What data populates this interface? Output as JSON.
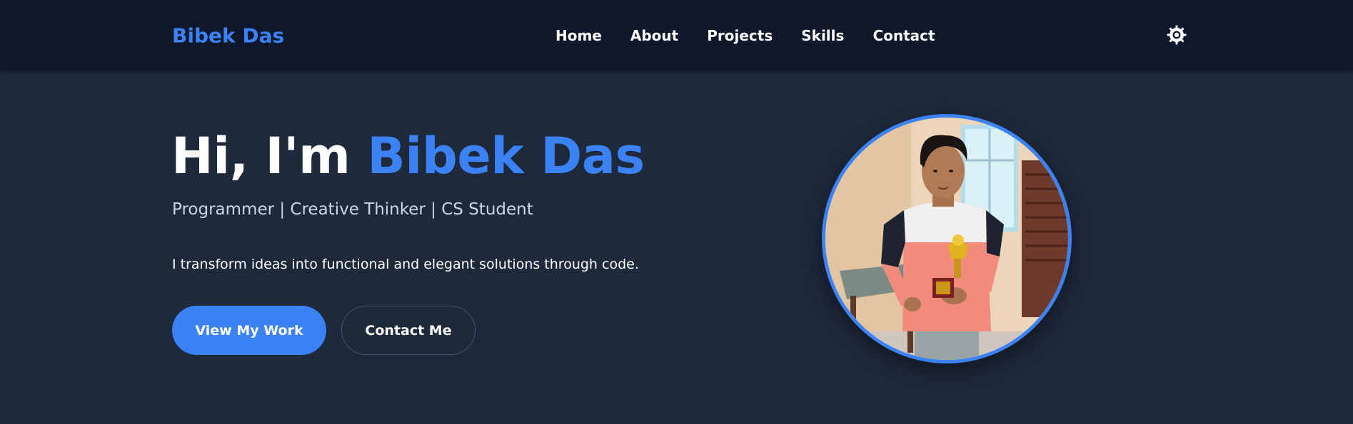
{
  "header": {
    "brand": "Bibek Das",
    "nav": [
      {
        "label": "Home"
      },
      {
        "label": "About"
      },
      {
        "label": "Projects"
      },
      {
        "label": "Skills"
      },
      {
        "label": "Contact"
      }
    ],
    "theme_toggle_icon": "sun-icon"
  },
  "hero": {
    "greeting": "Hi, I'm",
    "name": "Bibek Das",
    "subtitle": "Programmer | Creative Thinker | CS Student",
    "description": "I transform ideas into functional and elegant solutions through code.",
    "primary_button": "View My Work",
    "secondary_button": "Contact Me"
  },
  "colors": {
    "accent": "#3b82f6",
    "header_bg": "#0f172a",
    "page_bg": "#1e293b"
  }
}
